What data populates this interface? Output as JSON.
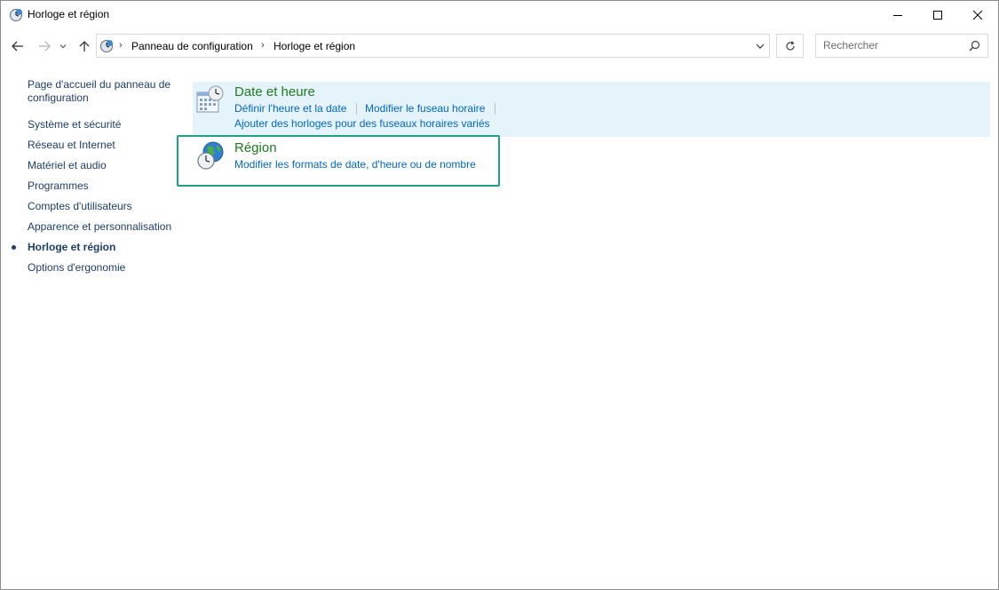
{
  "window": {
    "title": "Horloge et région",
    "controls": {
      "minimize": "minimize",
      "maximize": "maximize",
      "close": "close"
    }
  },
  "address": {
    "breadcrumbs": [
      "Panneau de configuration",
      "Horloge et région"
    ]
  },
  "search": {
    "placeholder": "Rechercher"
  },
  "sidebar": {
    "items": [
      {
        "label": "Page d'accueil du panneau de configuration"
      },
      {
        "label": "Système et sécurité"
      },
      {
        "label": "Réseau et Internet"
      },
      {
        "label": "Matériel et audio"
      },
      {
        "label": "Programmes"
      },
      {
        "label": "Comptes d'utilisateurs"
      },
      {
        "label": "Apparence et personnalisation"
      },
      {
        "label": "Horloge et région",
        "active": true
      },
      {
        "label": "Options d'ergonomie"
      }
    ]
  },
  "categories": [
    {
      "title": "Date et heure",
      "icon": "calendar-clock-icon",
      "links": [
        "Définir l'heure et la date",
        "Modifier le fuseau horaire",
        "Ajouter des horloges pour des fuseaux horaires variés"
      ]
    },
    {
      "title": "Région",
      "icon": "globe-clock-icon",
      "links": [
        "Modifier les formats de date, d'heure ou de nombre"
      ]
    }
  ],
  "colors": {
    "category_title": "#1e7b1e",
    "link": "#0066cc",
    "sidebar_link": "#1e3d6a",
    "highlight": "#e5f3fb",
    "focus_border": "#1fa085"
  }
}
